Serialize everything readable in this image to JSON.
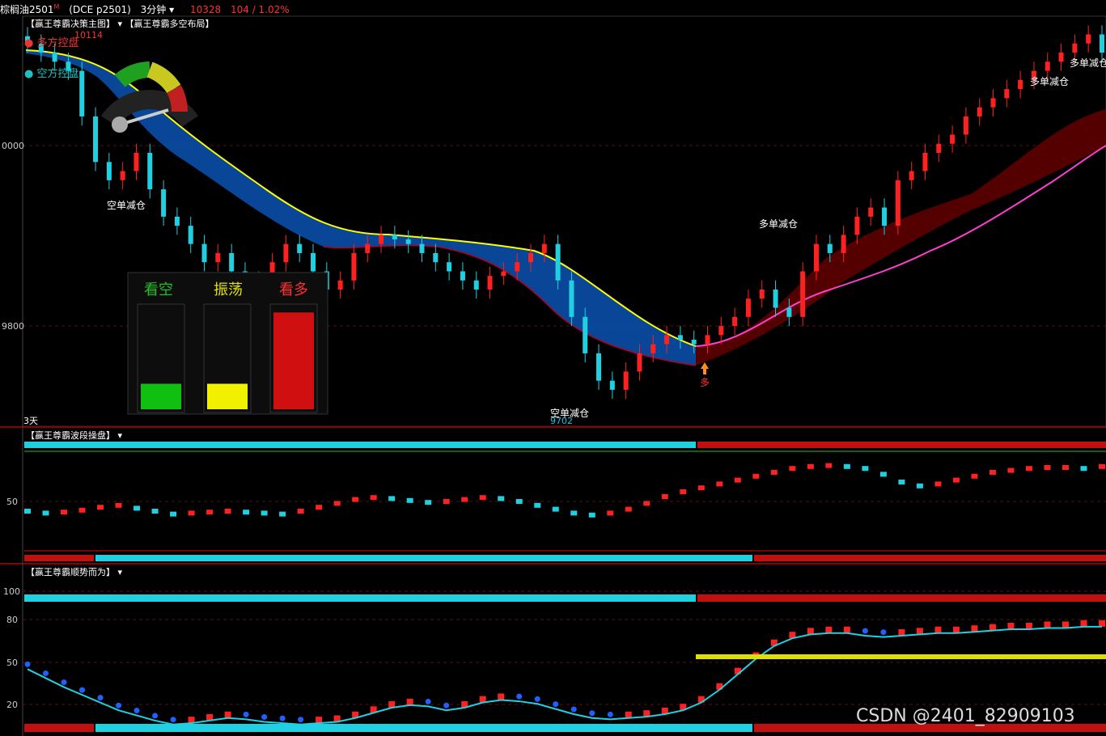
{
  "header": {
    "symbol": "棕榈油2501",
    "symbol_tag": "M",
    "contract": "(DCE p2501)",
    "period": "3分钟",
    "last_price": "10328",
    "change": "104 / 1.02%"
  },
  "panel_titles": {
    "main_title": "【赢王尊霸决策主图】",
    "main_title2": "【赢王尊霸多空布局】",
    "wave_title": "【赢王尊霸波段操盘】",
    "trend_title": "【赢王尊霸顺势而为】"
  },
  "legend": {
    "bull": "多方控盘",
    "bear": "空方控盘"
  },
  "gauge": {
    "bear_label": "看空",
    "neutral_label": "振荡",
    "bull_label": "看多",
    "bear_level": 0.25,
    "neutral_level": 0.25,
    "bull_level": 0.95
  },
  "annotations": {
    "high": "10114",
    "low": "9702",
    "short_reduce": "空单减仓",
    "long_reduce": "多单减仓",
    "long_signal": "多",
    "day_label": "3天"
  },
  "watermark": "CSDN @2401_82909103",
  "colors": {
    "bull": "#ff2020",
    "bear": "#20d0e0",
    "ma_fast": "#ffff00",
    "ma_slow": "#ff3fcf",
    "ribbon_bear": "#0a4aa0",
    "ribbon_bull": "#5a0000"
  },
  "chart_data": [
    {
      "type": "candlestick",
      "y_ticks": [
        10000,
        9800
      ],
      "ylim": [
        9680,
        10130
      ],
      "note_points": {
        "high": 10114,
        "low": 9702
      },
      "close_path": [
        10100,
        10090,
        10080,
        10070,
        10020,
        9970,
        9950,
        9960,
        9980,
        9940,
        9910,
        9900,
        9880,
        9860,
        9870,
        9850,
        9840,
        9830,
        9860,
        9880,
        9870,
        9850,
        9830,
        9840,
        9870,
        9880,
        9890,
        9885,
        9880,
        9870,
        9860,
        9850,
        9840,
        9830,
        9845,
        9850,
        9860,
        9870,
        9880,
        9840,
        9800,
        9760,
        9730,
        9720,
        9740,
        9760,
        9770,
        9780,
        9775,
        9770,
        9780,
        9790,
        9800,
        9820,
        9830,
        9810,
        9800,
        9850,
        9880,
        9870,
        9890,
        9910,
        9920,
        9900,
        9950,
        9960,
        9980,
        9990,
        10000,
        10020,
        10030,
        10040,
        10050,
        10060,
        10070,
        10080,
        10090,
        10100,
        10110,
        10090
      ]
    },
    {
      "type": "bar",
      "name_hint": "wave",
      "y_ticks": [
        50
      ],
      "ylim": [
        0,
        100
      ],
      "values": [
        40,
        38,
        39,
        41,
        44,
        46,
        43,
        40,
        37,
        38,
        39,
        40,
        39,
        38,
        37,
        40,
        44,
        48,
        52,
        54,
        53,
        51,
        49,
        50,
        52,
        54,
        53,
        50,
        46,
        42,
        38,
        36,
        38,
        42,
        48,
        55,
        60,
        64,
        68,
        72,
        76,
        80,
        84,
        86,
        87,
        86,
        84,
        78,
        70,
        66,
        68,
        72,
        76,
        80,
        82,
        84,
        85,
        85,
        84,
        86
      ]
    },
    {
      "type": "bar",
      "name_hint": "trend",
      "y_ticks": [
        100,
        80,
        50,
        20
      ],
      "ylim": [
        10,
        110
      ],
      "values": [
        62,
        55,
        48,
        42,
        36,
        30,
        26,
        22,
        19,
        20,
        22,
        24,
        23,
        21,
        20,
        19,
        20,
        21,
        24,
        28,
        32,
        34,
        33,
        30,
        32,
        36,
        38,
        37,
        35,
        31,
        27,
        24,
        23,
        24,
        25,
        27,
        30,
        36,
        46,
        58,
        70,
        80,
        86,
        89,
        90,
        90,
        88,
        87,
        88,
        89,
        90,
        90,
        91,
        92,
        93,
        93,
        94,
        94,
        95,
        95
      ]
    }
  ]
}
